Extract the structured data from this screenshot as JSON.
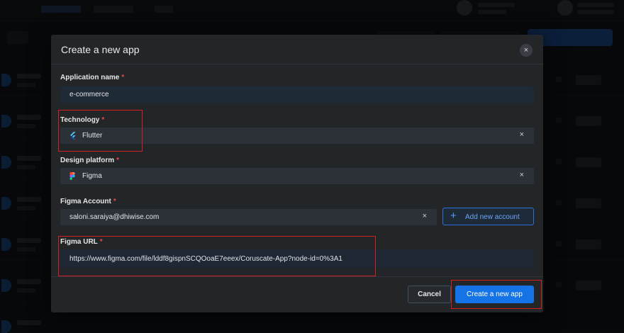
{
  "modal": {
    "title": "Create a new app",
    "close_glyph": "×",
    "application_name": {
      "label": "Application name",
      "required_mark": "*",
      "value": "e-commerce"
    },
    "technology": {
      "label": "Technology",
      "required_mark": "*",
      "value": "Flutter",
      "icon": "flutter-icon",
      "clear_glyph": "×"
    },
    "design_platform": {
      "label": "Design platform",
      "required_mark": "*",
      "value": "Figma",
      "icon": "figma-icon",
      "clear_glyph": "×"
    },
    "figma_account": {
      "label": "Figma Account",
      "required_mark": "*",
      "value": "saloni.saraiya@dhiwise.com",
      "clear_glyph": "×",
      "add_button_glyph": "+",
      "add_button_label": "Add new account"
    },
    "figma_url": {
      "label": "Figma URL",
      "required_mark": "*",
      "value": "https://www.figma.com/file/lddf8gispnSCQOoaE7eeex/Coruscate-App?node-id=0%3A1"
    },
    "cancel_label": "Cancel",
    "create_label": "Create a new app"
  },
  "colors": {
    "primary": "#1473e6",
    "required": "#e5484d",
    "annotation": "#d71f1f",
    "flutter_blue": "#47c5fb",
    "figma_red": "#f24e1e",
    "figma_purple": "#a259ff",
    "figma_green": "#0acf83",
    "figma_blue": "#1abcfe"
  }
}
